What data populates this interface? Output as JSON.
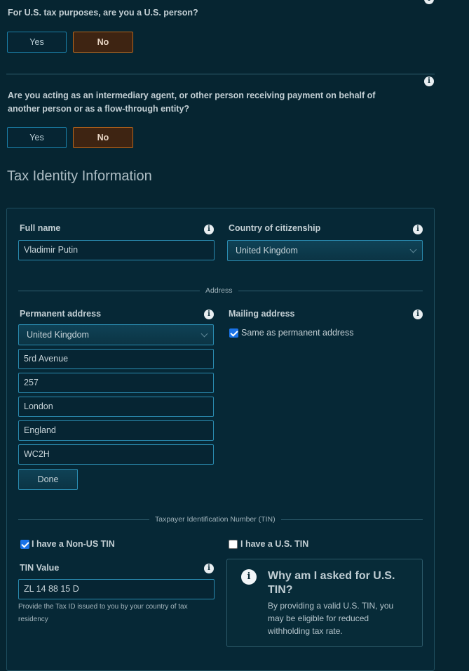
{
  "questions": [
    {
      "text": "For U.S. tax purposes, are you a U.S. person?",
      "yes": "Yes",
      "no": "No"
    },
    {
      "text": "Are you acting as an intermediary agent, or other person receiving payment on behalf of another person or as a flow-through entity?",
      "yes": "Yes",
      "no": "No"
    }
  ],
  "section_title": "Tax Identity Information",
  "full_name": {
    "label": "Full name",
    "value": "Vladimir Putin"
  },
  "citizenship": {
    "label": "Country of citizenship",
    "value": "United Kingdom"
  },
  "address_divider": "Address",
  "permanent_address": {
    "label": "Permanent address",
    "country": "United Kingdom",
    "line1": "5rd Avenue",
    "line2": "257",
    "city": "London",
    "region": "England",
    "postcode": "WC2H",
    "done_label": "Done"
  },
  "mailing_address": {
    "label": "Mailing address",
    "same_label": "Same as permanent address"
  },
  "tin_divider": "Taxpayer Identification Number (TIN)",
  "non_us_tin": {
    "label": "I have a Non-US TIN",
    "checked": true
  },
  "us_tin": {
    "label": "I have a U.S. TIN",
    "checked": false
  },
  "tin_value": {
    "label": "TIN Value",
    "value": "ZL 14 88 15 D",
    "hint": "Provide the Tax ID issued to you by your country of tax residency"
  },
  "tin_info": {
    "title": "Why am I asked for U.S. TIN?",
    "body": "By providing a valid U.S. TIN, you may be eligible for reduced withholding tax rate."
  },
  "icons": {
    "info": "info-icon",
    "chevron": "chevron-down-icon",
    "checkbox": "checkbox-icon"
  },
  "colors": {
    "background": "#062531",
    "accent_blue": "#1a7ea6",
    "no_button": "#b5651d",
    "checkbox": "#1a73e8"
  }
}
